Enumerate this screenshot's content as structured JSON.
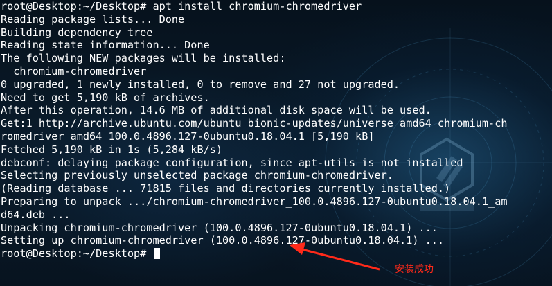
{
  "terminal": {
    "lines": [
      "root@Desktop:~/Desktop# apt install chromium-chromedriver",
      "Reading package lists... Done",
      "Building dependency tree",
      "Reading state information... Done",
      "The following NEW packages will be installed:",
      "  chromium-chromedriver",
      "0 upgraded, 1 newly installed, 0 to remove and 27 not upgraded.",
      "Need to get 5,190 kB of archives.",
      "After this operation, 14.6 MB of additional disk space will be used.",
      "Get:1 http://archive.ubuntu.com/ubuntu bionic-updates/universe amd64 chromium-ch",
      "romedriver amd64 100.0.4896.127-0ubuntu0.18.04.1 [5,190 kB]",
      "Fetched 5,190 kB in 1s (5,284 kB/s)",
      "debconf: delaying package configuration, since apt-utils is not installed",
      "Selecting previously unselected package chromium-chromedriver.",
      "(Reading database ... 71815 files and directories currently installed.)",
      "Preparing to unpack .../chromium-chromedriver_100.0.4896.127-0ubuntu0.18.04.1_am",
      "d64.deb ...",
      "Unpacking chromium-chromedriver (100.0.4896.127-0ubuntu0.18.04.1) ...",
      "Setting up chromium-chromedriver (100.0.4896.127-0ubuntu0.18.04.1) ..."
    ],
    "prompt": "root@Desktop:~/Desktop# "
  },
  "annotation": {
    "label": "安装成功",
    "color": "#ff2a1a"
  },
  "watermark": {
    "icon": "brand-logo-icon"
  }
}
